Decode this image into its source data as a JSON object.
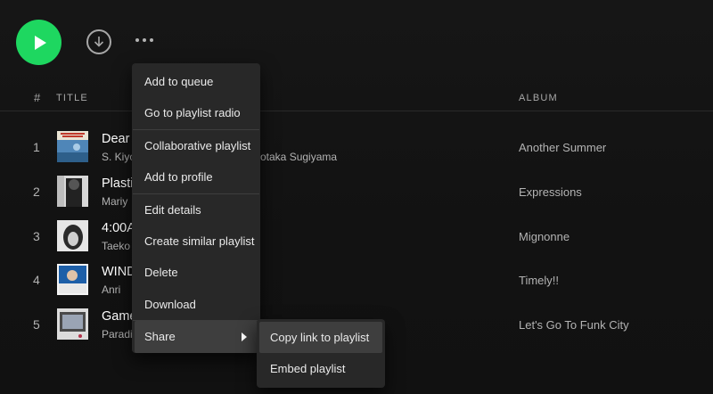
{
  "controls": {
    "play_icon": "play-icon",
    "download_icon": "download-circle-icon",
    "more_icon": "more-horizontal-icon",
    "accent_color": "#1ed760"
  },
  "table_header": {
    "number": "#",
    "title": "TITLE",
    "album": "ALBUM"
  },
  "tracks": [
    {
      "num": "1",
      "title": "Dear",
      "artist": "S. Kiyo",
      "album": "Another Summer",
      "cover_icon": "album-cover-blue"
    },
    {
      "num": "2",
      "title": "Plasti",
      "artist": "Mariy",
      "album": "Expressions",
      "cover_icon": "album-cover-bw-portrait"
    },
    {
      "num": "3",
      "title": "4:00A",
      "artist": "Taeko",
      "album": "Mignonne",
      "cover_icon": "album-cover-bw-face"
    },
    {
      "num": "4",
      "title": "WIND",
      "artist": "Anri",
      "album": "Timely!!",
      "cover_icon": "album-cover-blue-portrait"
    },
    {
      "num": "5",
      "title": "Game",
      "artist": "Paradi",
      "album": "Let's Go To Funk City",
      "cover_icon": "album-cover-gameboy"
    }
  ],
  "track1_artist_visible_tail": "otaka Sugiyama",
  "context_menu": {
    "items": [
      {
        "label": "Add to queue"
      },
      {
        "label": "Go to playlist radio"
      },
      {
        "label": "Collaborative playlist"
      },
      {
        "label": "Add to profile"
      },
      {
        "label": "Edit details"
      },
      {
        "label": "Create similar playlist"
      },
      {
        "label": "Delete"
      },
      {
        "label": "Download"
      },
      {
        "label": "Share"
      }
    ]
  },
  "share_submenu": {
    "items": [
      {
        "label": "Copy link to playlist"
      },
      {
        "label": "Embed playlist"
      }
    ]
  }
}
